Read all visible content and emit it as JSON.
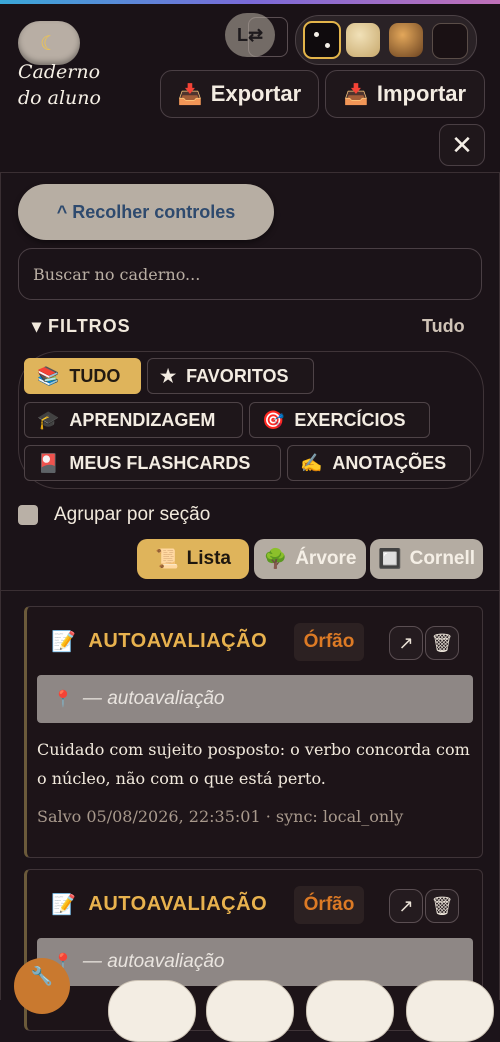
{
  "header": {
    "theme_icon": "crescent-moon-icon",
    "brand_line1": "Caderno",
    "brand_line2": "do aluno",
    "swap_icon_text": "L⇄",
    "export_label": "Exportar",
    "import_label": "Importar",
    "close_glyph": "✕",
    "theme_swatches": [
      "#0f0b0d",
      "#d8c28c",
      "#a8692e",
      "#1a1114"
    ]
  },
  "controls": {
    "collapse_label": "^ Recolher controles",
    "search_placeholder": "Buscar no caderno...",
    "filters_title": "▾ FILTROS",
    "filters_all": "Tudo",
    "chips": [
      {
        "icon": "📚",
        "label": "TUDO",
        "active": true
      },
      {
        "icon": "★",
        "label": "FAVORITOS",
        "active": false
      },
      {
        "icon": "🎓",
        "label": "APRENDIZAGEM",
        "active": false
      },
      {
        "icon": "🎯",
        "label": "EXERCÍCIOS",
        "active": false
      },
      {
        "icon": "🎴",
        "label": "MEUS FLASHCARDS",
        "active": false
      },
      {
        "icon": "✍",
        "label": "ANOTAÇÕES",
        "active": false
      }
    ],
    "group_label": "Agrupar por seção",
    "views": [
      {
        "icon": "📜",
        "label": "Lista",
        "active": true
      },
      {
        "icon": "🌳",
        "label": "Árvore",
        "active": false
      },
      {
        "icon": "🔲",
        "label": "Cornell",
        "active": false
      }
    ]
  },
  "cards": [
    {
      "icon": "📝",
      "title": "AUTOAVALIAÇÃO",
      "badge": "Órfão",
      "open_glyph": "↗",
      "delete_glyph": "🗑",
      "location": "— autoavaliação",
      "text": "Cuidado com sujeito posposto: o verbo concorda com o núcleo, não com o que está perto.",
      "meta": "Salvo 05/08/2026, 22:35:01 · sync: local_only"
    },
    {
      "icon": "📝",
      "title": "AUTOAVALIAÇÃO",
      "badge": "Órfão",
      "open_glyph": "↗",
      "delete_glyph": "🗑",
      "location": "— autoavaliação"
    }
  ],
  "fab_icon": "🔧",
  "colors": {
    "accent_gold": "#dfb45b",
    "title_gold": "#e8b24e",
    "orphan_orange": "#dc7a25",
    "background": "#1c141a"
  }
}
